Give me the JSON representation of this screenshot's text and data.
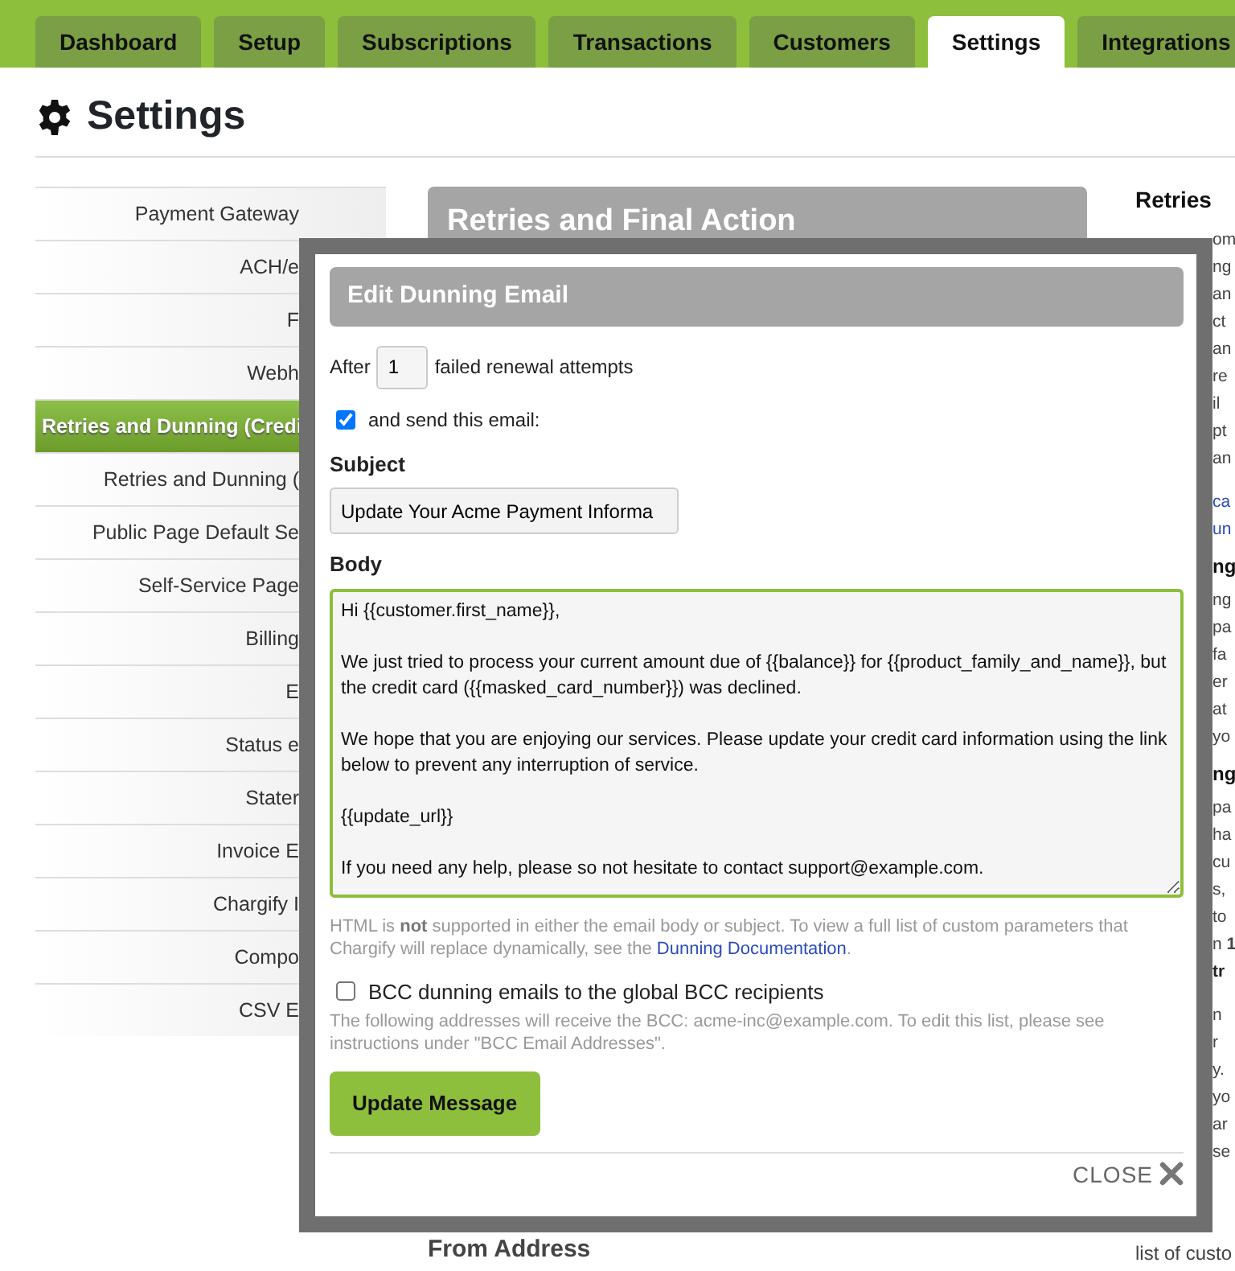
{
  "tabs": [
    {
      "label": "Dashboard",
      "selected": false
    },
    {
      "label": "Setup",
      "selected": false
    },
    {
      "label": "Subscriptions",
      "selected": false
    },
    {
      "label": "Transactions",
      "selected": false
    },
    {
      "label": "Customers",
      "selected": false
    },
    {
      "label": "Settings",
      "selected": true
    },
    {
      "label": "Integrations",
      "selected": false
    }
  ],
  "page_title": "Settings",
  "sidebar": {
    "items": [
      {
        "label": "Payment Gateway",
        "selected": false
      },
      {
        "label": "ACH/e",
        "selected": false
      },
      {
        "label": "F",
        "selected": false
      },
      {
        "label": "Webh",
        "selected": false
      },
      {
        "label": "Retries and Dunning (Credi",
        "selected": true
      },
      {
        "label": "Retries and Dunning (",
        "selected": false
      },
      {
        "label": "Public Page Default Se",
        "selected": false
      },
      {
        "label": "Self-Service Page",
        "selected": false
      },
      {
        "label": "Billing",
        "selected": false
      },
      {
        "label": "E",
        "selected": false
      },
      {
        "label": "Status e",
        "selected": false
      },
      {
        "label": "Stater",
        "selected": false
      },
      {
        "label": "Invoice E",
        "selected": false
      },
      {
        "label": "Chargify I",
        "selected": false
      },
      {
        "label": "Compo",
        "selected": false
      },
      {
        "label": "CSV E",
        "selected": false
      }
    ]
  },
  "main": {
    "section_title": "Retries and Final Action",
    "bottom_heading": "From Address"
  },
  "right_panel": {
    "heading": "Retries",
    "lines": [
      {
        "text": "om",
        "kind": "text"
      },
      {
        "text": "ng",
        "kind": "text"
      },
      {
        "text": "an",
        "kind": "text"
      },
      {
        "text": "ct",
        "kind": "text"
      },
      {
        "text": "an",
        "kind": "text"
      },
      {
        "text": "re",
        "kind": "text"
      },
      {
        "text": "il",
        "kind": "text"
      },
      {
        "text": "pt",
        "kind": "text"
      },
      {
        "text": "an",
        "kind": "text"
      },
      {
        "text": "ca",
        "kind": "link",
        "gap_before": true
      },
      {
        "text": "un",
        "kind": "link"
      },
      {
        "text": "ng",
        "kind": "heading"
      },
      {
        "text": "ng",
        "kind": "text"
      },
      {
        "text": "pa",
        "kind": "text"
      },
      {
        "text": "fa",
        "kind": "text"
      },
      {
        "text": "er",
        "kind": "text"
      },
      {
        "text": "at",
        "kind": "text"
      },
      {
        "text": "yo",
        "kind": "text"
      },
      {
        "text": "ng",
        "kind": "heading"
      },
      {
        "text": "pa",
        "kind": "text"
      },
      {
        "text": "ha",
        "kind": "text"
      },
      {
        "text": "cu",
        "kind": "text"
      },
      {
        "text": "s,",
        "kind": "text"
      },
      {
        "text": "to",
        "kind": "text"
      },
      {
        "text": "n **1**",
        "kind": "text"
      },
      {
        "text": "tr",
        "kind": "bold"
      },
      {
        "text": "n",
        "kind": "text",
        "gap_before": true
      },
      {
        "text": "r",
        "kind": "text"
      },
      {
        "text": "y.",
        "kind": "text"
      },
      {
        "text": "yo",
        "kind": "text"
      },
      {
        "text": "ar",
        "kind": "text"
      },
      {
        "text": "se",
        "kind": "text"
      },
      {
        "text": "list of custo",
        "kind": "below"
      }
    ]
  },
  "modal": {
    "title": "Edit Dunning Email",
    "after_label": "After",
    "attempts_value": "1",
    "attempts_label": "failed renewal attempts",
    "send_email": {
      "label": "and send this email:",
      "checked": true
    },
    "subject_label": "Subject",
    "subject_value": "Update Your Acme Payment Informa",
    "body_label": "Body",
    "body_value": "Hi {{customer.first_name}},\n\nWe just tried to process your current amount due of {{balance}} for {{product_family_and_name}}, but the credit card ({{masked_card_number}}) was declined.\n\nWe hope that you are enjoying our services. Please update your credit card information using the link below to prevent any interruption of service. \n\n{{update_url}}\n\nIf you need any help, please so not hesitate to contact support@example.com.",
    "help_text": "HTML is **not** supported in either the email body or subject. To view a full list of custom parameters that Chargify will replace dynamically, see the",
    "help_link": "Dunning Documentation",
    "help_end": ".",
    "bcc": {
      "label": "BCC dunning emails to the global BCC recipients",
      "checked": false
    },
    "bcc_note": "The following addresses will receive the BCC: acme-inc@example.com. To edit this list, please see instructions under \"BCC Email Addresses\".",
    "submit": "Update Message",
    "close": "CLOSE"
  }
}
